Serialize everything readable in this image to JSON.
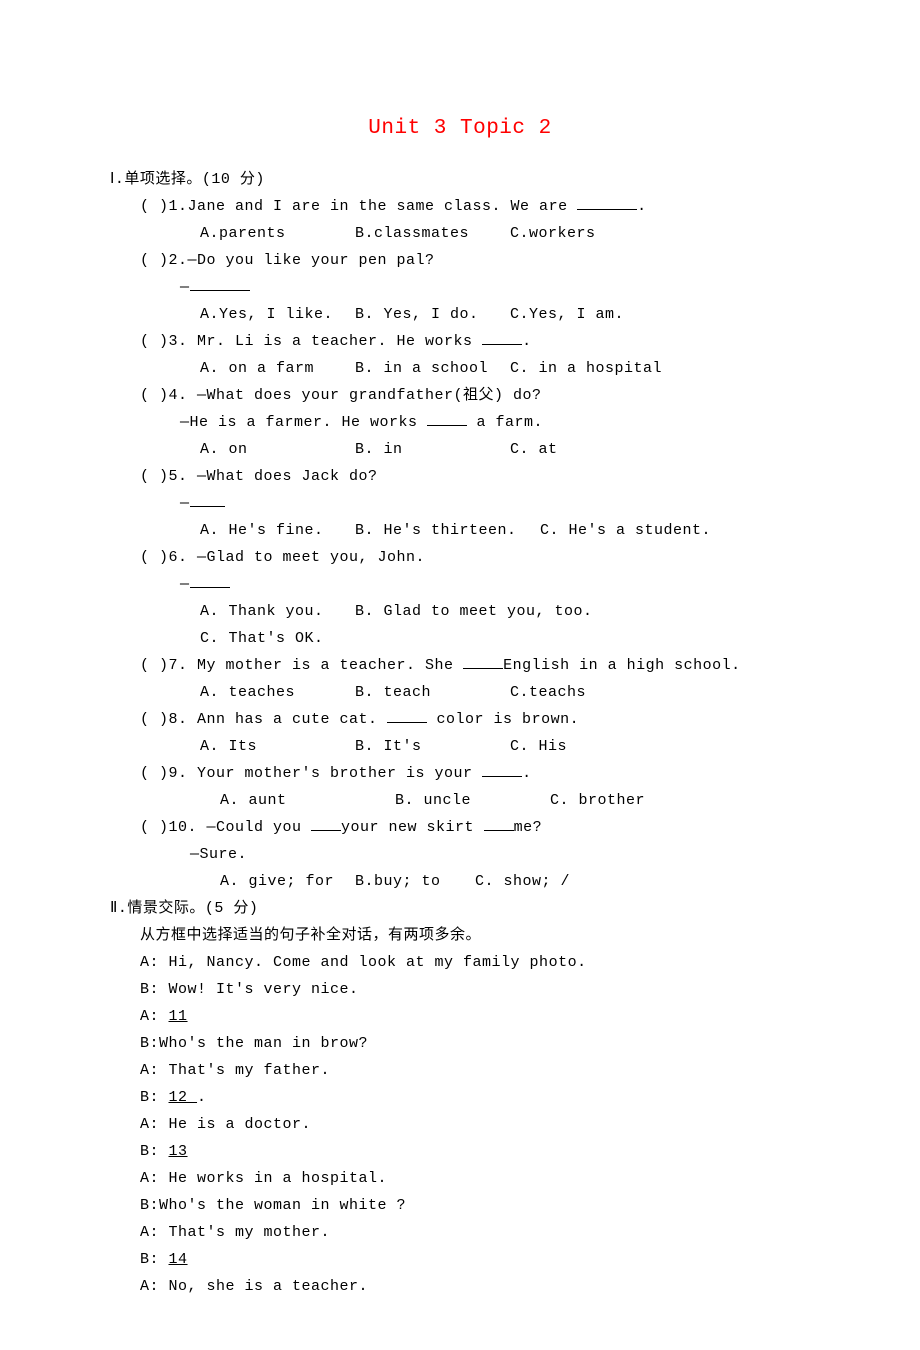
{
  "title": "Unit 3 Topic 2",
  "s1": {
    "label": "Ⅰ.单项选择。(10 分)",
    "q1": {
      "stem": "(   )1.Jane and I are in the same class. We are ",
      "tail": ".",
      "a": "A.parents",
      "b": "B.classmates",
      "c": "C.workers"
    },
    "q2": {
      "stem": "(   )2.—Do you like your pen pal?",
      "dash": "—",
      "a": "A.Yes, I like.",
      "b": "B. Yes, I do.",
      "c": "C.Yes, I am."
    },
    "q3": {
      "stem": "(   )3. Mr. Li is a teacher. He works ",
      "tail": ".",
      "a": "A. on a farm",
      "b": "B. in a school",
      "c": "C. in a hospital"
    },
    "q4": {
      "stem": "(   )4. —What does your grandfather(祖父) do?",
      "line2a": "—He is a farmer. He works ",
      "line2b": " a farm.",
      "a": "A. on",
      "b": "B. in",
      "c": "C. at"
    },
    "q5": {
      "stem": "(   )5. —What does Jack do?",
      "dash": "—",
      "a": "A. He's fine.",
      "b": "B.  He's thirteen.",
      "c": "C.   He's a student."
    },
    "q6": {
      "stem": "(   )6. —Glad to meet you, John.",
      "dash": "—",
      "a": "A. Thank you.",
      "b": "B. Glad to meet you, too.",
      "c": "C. That's OK."
    },
    "q7": {
      "stem1": "(   )7. My mother is a teacher. She ",
      "stem2": "English in a high school.",
      "a": "A. teaches",
      "b": "B. teach",
      "c": "C.teachs"
    },
    "q8": {
      "stem1": "(   )8. Ann has a cute cat. ",
      "stem2": " color is brown.",
      "a": "A. Its",
      "b": "B. It's",
      "c": "C. His"
    },
    "q9": {
      "stem1": "(   )9. Your mother's brother is your ",
      "stem2": ".",
      "a": "A. aunt",
      "b": "B. uncle",
      "c": "C. brother"
    },
    "q10": {
      "stem1": "(   )10. —Could you ",
      "stem2": "your new skirt ",
      "stem3": "me?",
      "line2": "—Sure.",
      "a": "A. give; for",
      "b": "B.buy; to",
      "c": "C. show; /"
    }
  },
  "s2": {
    "label": "Ⅱ.情景交际。(5 分)",
    "instr": "从方框中选择适当的句子补全对话，有两项多余。",
    "lines": [
      "A: Hi, Nancy. Come and look at my family photo.",
      "B: Wow! It's very nice.",
      "A: ",
      "B:Who's the man in brow?",
      "A: That's my father.",
      "B: ",
      "A: He is a doctor.",
      "B: ",
      "A: He works in a hospital.",
      "B:Who's the woman in white ?",
      "A: That's my mother.",
      "B: ",
      "A: No, she is a teacher."
    ],
    "blanks": {
      "b11": " 11  ",
      "b12": "  12 ",
      "b12tail": ".",
      "b13": "  13  ",
      "b14": "  14  "
    }
  }
}
